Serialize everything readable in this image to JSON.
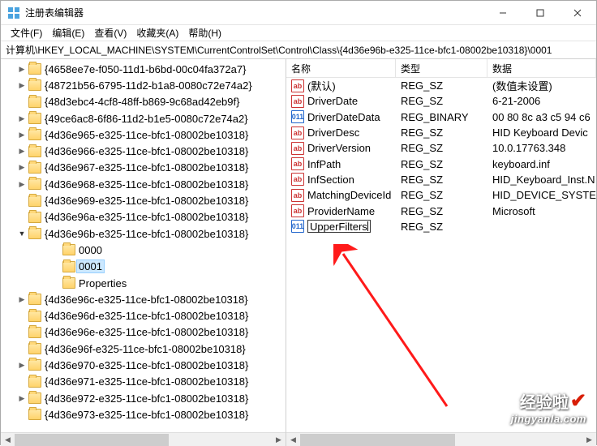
{
  "titlebar": {
    "title": "注册表编辑器"
  },
  "menu": {
    "file": "文件(F)",
    "edit": "编辑(E)",
    "view": "查看(V)",
    "fav": "收藏夹(A)",
    "help": "帮助(H)"
  },
  "address": "计算机\\HKEY_LOCAL_MACHINE\\SYSTEM\\CurrentControlSet\\Control\\Class\\{4d36e96b-e325-11ce-bfc1-08002be10318}\\0001",
  "tree": [
    {
      "label": "{4658ee7e-f050-11d1-b6bd-00c04fa372a7}",
      "exp": ">",
      "indent": 0
    },
    {
      "label": "{48721b56-6795-11d2-b1a8-0080c72e74a2}",
      "exp": ">",
      "indent": 0
    },
    {
      "label": "{48d3ebc4-4cf8-48ff-b869-9c68ad42eb9f}",
      "exp": "",
      "indent": 0
    },
    {
      "label": "{49ce6ac8-6f86-11d2-b1e5-0080c72e74a2}",
      "exp": ">",
      "indent": 0
    },
    {
      "label": "{4d36e965-e325-11ce-bfc1-08002be10318}",
      "exp": ">",
      "indent": 0
    },
    {
      "label": "{4d36e966-e325-11ce-bfc1-08002be10318}",
      "exp": ">",
      "indent": 0
    },
    {
      "label": "{4d36e967-e325-11ce-bfc1-08002be10318}",
      "exp": ">",
      "indent": 0
    },
    {
      "label": "{4d36e968-e325-11ce-bfc1-08002be10318}",
      "exp": ">",
      "indent": 0
    },
    {
      "label": "{4d36e969-e325-11ce-bfc1-08002be10318}",
      "exp": "",
      "indent": 0
    },
    {
      "label": "{4d36e96a-e325-11ce-bfc1-08002be10318}",
      "exp": "",
      "indent": 0
    },
    {
      "label": "{4d36e96b-e325-11ce-bfc1-08002be10318}",
      "exp": "v",
      "indent": 0
    },
    {
      "label": "0000",
      "exp": "",
      "indent": 2
    },
    {
      "label": "0001",
      "exp": "",
      "indent": 2,
      "selected": true
    },
    {
      "label": "Properties",
      "exp": "",
      "indent": 2
    },
    {
      "label": "{4d36e96c-e325-11ce-bfc1-08002be10318}",
      "exp": ">",
      "indent": 0
    },
    {
      "label": "{4d36e96d-e325-11ce-bfc1-08002be10318}",
      "exp": "",
      "indent": 0
    },
    {
      "label": "{4d36e96e-e325-11ce-bfc1-08002be10318}",
      "exp": "",
      "indent": 0
    },
    {
      "label": "{4d36e96f-e325-11ce-bfc1-08002be10318}",
      "exp": "",
      "indent": 0
    },
    {
      "label": "{4d36e970-e325-11ce-bfc1-08002be10318}",
      "exp": ">",
      "indent": 0
    },
    {
      "label": "{4d36e971-e325-11ce-bfc1-08002be10318}",
      "exp": "",
      "indent": 0
    },
    {
      "label": "{4d36e972-e325-11ce-bfc1-08002be10318}",
      "exp": ">",
      "indent": 0
    },
    {
      "label": "{4d36e973-e325-11ce-bfc1-08002be10318}",
      "exp": "",
      "indent": 0
    }
  ],
  "columns": {
    "name": "名称",
    "type": "类型",
    "data": "数据"
  },
  "values": [
    {
      "icon": "str",
      "name": "(默认)",
      "type": "REG_SZ",
      "data": "(数值未设置)"
    },
    {
      "icon": "str",
      "name": "DriverDate",
      "type": "REG_SZ",
      "data": "6-21-2006"
    },
    {
      "icon": "bin",
      "name": "DriverDateData",
      "type": "REG_BINARY",
      "data": "00 80 8c a3 c5 94 c6"
    },
    {
      "icon": "str",
      "name": "DriverDesc",
      "type": "REG_SZ",
      "data": "HID Keyboard Devic"
    },
    {
      "icon": "str",
      "name": "DriverVersion",
      "type": "REG_SZ",
      "data": "10.0.17763.348"
    },
    {
      "icon": "str",
      "name": "InfPath",
      "type": "REG_SZ",
      "data": "keyboard.inf"
    },
    {
      "icon": "str",
      "name": "InfSection",
      "type": "REG_SZ",
      "data": "HID_Keyboard_Inst.N"
    },
    {
      "icon": "str",
      "name": "MatchingDeviceId",
      "type": "REG_SZ",
      "data": "HID_DEVICE_SYSTEM"
    },
    {
      "icon": "str",
      "name": "ProviderName",
      "type": "REG_SZ",
      "data": "Microsoft"
    },
    {
      "icon": "bin",
      "name": "UpperFilters",
      "type": "REG_SZ",
      "data": "",
      "editing": true
    }
  ],
  "iconText": {
    "str": "ab",
    "bin": "011"
  },
  "watermark": {
    "line1": "经验啦",
    "line2": "jingyanla.com"
  }
}
